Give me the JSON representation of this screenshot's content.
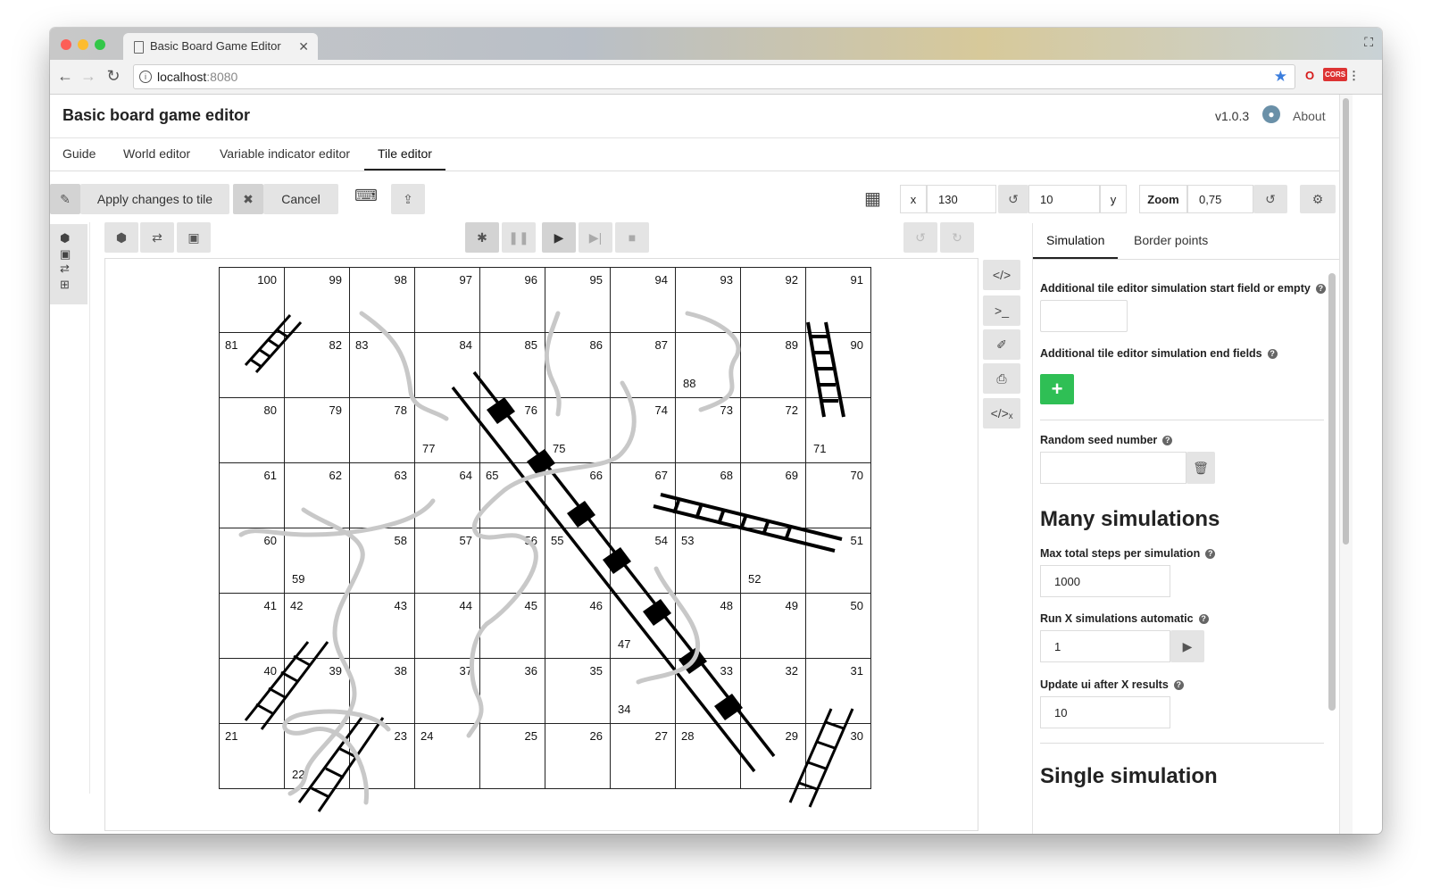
{
  "browser": {
    "tab_title": "Basic Board Game Editor",
    "url_host": "localhost",
    "url_port": ":8080"
  },
  "app": {
    "title": "Basic board game editor",
    "version": "v1.0.3",
    "about": "About"
  },
  "nav": {
    "tabs": [
      "Guide",
      "World editor",
      "Variable indicator editor",
      "Tile editor"
    ],
    "active": "Tile editor"
  },
  "toolbar": {
    "apply_label": "Apply changes to tile",
    "cancel_label": "Cancel",
    "x_label": "x",
    "x_value": "130",
    "y_label": "y",
    "y_value": "10",
    "zoom_label": "Zoom",
    "zoom_value": "0,75"
  },
  "board": {
    "cells": [
      [
        100,
        99,
        98,
        97,
        96,
        95,
        94,
        93,
        92,
        91
      ],
      [
        81,
        82,
        83,
        84,
        85,
        86,
        87,
        88,
        89,
        90
      ],
      [
        80,
        79,
        78,
        77,
        76,
        75,
        74,
        73,
        72,
        71
      ],
      [
        61,
        62,
        63,
        64,
        65,
        66,
        67,
        68,
        69,
        70
      ],
      [
        60,
        59,
        58,
        57,
        56,
        55,
        54,
        53,
        52,
        51
      ],
      [
        41,
        42,
        43,
        44,
        45,
        46,
        47,
        48,
        49,
        50
      ],
      [
        40,
        39,
        38,
        37,
        36,
        35,
        34,
        33,
        32,
        31
      ],
      [
        21,
        22,
        23,
        24,
        25,
        26,
        27,
        28,
        29,
        30
      ]
    ]
  },
  "panel": {
    "tabs": [
      "Simulation",
      "Border points"
    ],
    "start_field_label": "Additional tile editor simulation start field or empty",
    "start_field_value": "",
    "end_fields_label": "Additional tile editor simulation end fields",
    "add_label": "+",
    "seed_label": "Random seed number",
    "seed_value": "",
    "many_title": "Many simulations",
    "max_steps_label": "Max total steps per simulation",
    "max_steps_value": "1000",
    "run_x_label": "Run X simulations automatic",
    "run_x_value": "1",
    "update_ui_label": "Update ui after X results",
    "update_ui_value": "10",
    "single_title": "Single simulation"
  }
}
